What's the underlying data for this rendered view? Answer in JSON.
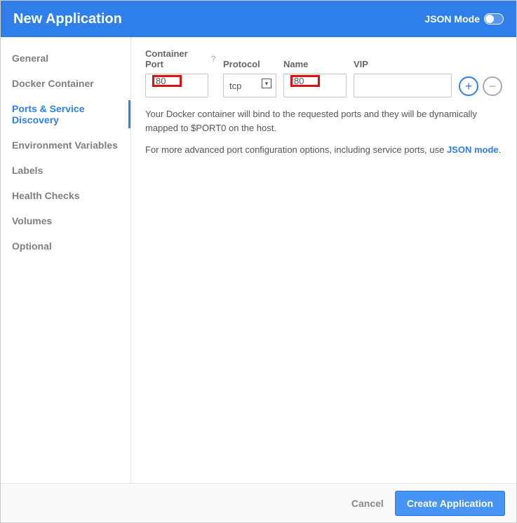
{
  "header": {
    "title": "New Application",
    "json_mode_label": "JSON Mode"
  },
  "sidebar": {
    "items": [
      {
        "label": "General"
      },
      {
        "label": "Docker Container"
      },
      {
        "label": "Ports & Service Discovery"
      },
      {
        "label": "Environment Variables"
      },
      {
        "label": "Labels"
      },
      {
        "label": "Health Checks"
      },
      {
        "label": "Volumes"
      },
      {
        "label": "Optional"
      }
    ],
    "active_index": 2
  },
  "ports": {
    "labels": {
      "container_port": "Container Port",
      "protocol": "Protocol",
      "name": "Name",
      "vip": "VIP"
    },
    "row": {
      "container_port": "80",
      "protocol": "tcp",
      "name": "80",
      "vip": ""
    },
    "hint_line1": "Your Docker container will bind to the requested ports and they will be dynamically mapped to $PORT0 on the host.",
    "hint_line2_prefix": "For more advanced port configuration options, including service ports, use ",
    "hint_link_text": "JSON mode",
    "hint_line2_suffix": "."
  },
  "footer": {
    "cancel": "Cancel",
    "submit": "Create Application"
  }
}
